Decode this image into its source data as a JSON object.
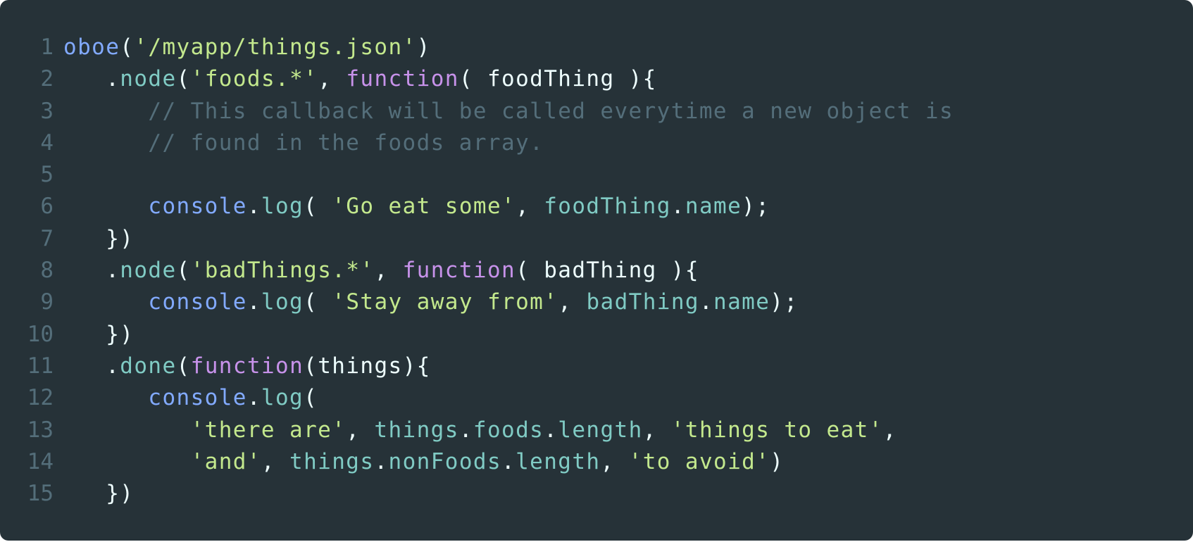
{
  "colors": {
    "background": "#263238",
    "line_number": "#546e7a",
    "function": "#82aaff",
    "string": "#c3e88d",
    "keyword": "#c792ea",
    "property": "#80cbc4",
    "comment": "#546e7a",
    "plain": "#eeffff"
  },
  "lines": [
    {
      "number": "1",
      "indent": "",
      "tokens": [
        {
          "t": "oboe",
          "c": "func"
        },
        {
          "t": "(",
          "c": "plain"
        },
        {
          "t": "'/myapp/things.json'",
          "c": "str"
        },
        {
          "t": ")",
          "c": "plain"
        }
      ]
    },
    {
      "number": "2",
      "indent": "   ",
      "tokens": [
        {
          "t": ".",
          "c": "plain"
        },
        {
          "t": "node",
          "c": "prop"
        },
        {
          "t": "(",
          "c": "plain"
        },
        {
          "t": "'foods.*'",
          "c": "str"
        },
        {
          "t": ", ",
          "c": "plain"
        },
        {
          "t": "function",
          "c": "kw"
        },
        {
          "t": "( foodThing ){",
          "c": "plain"
        }
      ]
    },
    {
      "number": "3",
      "indent": "      ",
      "tokens": [
        {
          "t": "// This callback will be called everytime a new object is",
          "c": "com"
        }
      ]
    },
    {
      "number": "4",
      "indent": "      ",
      "tokens": [
        {
          "t": "// found in the foods array.",
          "c": "com"
        }
      ]
    },
    {
      "number": "5",
      "indent": "",
      "tokens": []
    },
    {
      "number": "6",
      "indent": "      ",
      "tokens": [
        {
          "t": "console",
          "c": "func"
        },
        {
          "t": ".",
          "c": "plain"
        },
        {
          "t": "log",
          "c": "prop"
        },
        {
          "t": "( ",
          "c": "plain"
        },
        {
          "t": "'Go eat some'",
          "c": "str"
        },
        {
          "t": ", ",
          "c": "plain"
        },
        {
          "t": "foodThing",
          "c": "prop"
        },
        {
          "t": ".",
          "c": "plain"
        },
        {
          "t": "name",
          "c": "prop"
        },
        {
          "t": ");",
          "c": "plain"
        }
      ]
    },
    {
      "number": "7",
      "indent": "   ",
      "tokens": [
        {
          "t": "})",
          "c": "plain"
        }
      ]
    },
    {
      "number": "8",
      "indent": "   ",
      "tokens": [
        {
          "t": ".",
          "c": "plain"
        },
        {
          "t": "node",
          "c": "prop"
        },
        {
          "t": "(",
          "c": "plain"
        },
        {
          "t": "'badThings.*'",
          "c": "str"
        },
        {
          "t": ", ",
          "c": "plain"
        },
        {
          "t": "function",
          "c": "kw"
        },
        {
          "t": "( badThing ){",
          "c": "plain"
        }
      ]
    },
    {
      "number": "9",
      "indent": "      ",
      "tokens": [
        {
          "t": "console",
          "c": "func"
        },
        {
          "t": ".",
          "c": "plain"
        },
        {
          "t": "log",
          "c": "prop"
        },
        {
          "t": "( ",
          "c": "plain"
        },
        {
          "t": "'Stay away from'",
          "c": "str"
        },
        {
          "t": ", ",
          "c": "plain"
        },
        {
          "t": "badThing",
          "c": "prop"
        },
        {
          "t": ".",
          "c": "plain"
        },
        {
          "t": "name",
          "c": "prop"
        },
        {
          "t": ");",
          "c": "plain"
        }
      ]
    },
    {
      "number": "10",
      "indent": "   ",
      "tokens": [
        {
          "t": "})",
          "c": "plain"
        }
      ]
    },
    {
      "number": "11",
      "indent": "   ",
      "tokens": [
        {
          "t": ".",
          "c": "plain"
        },
        {
          "t": "done",
          "c": "prop"
        },
        {
          "t": "(",
          "c": "plain"
        },
        {
          "t": "function",
          "c": "kw"
        },
        {
          "t": "(things){",
          "c": "plain"
        }
      ]
    },
    {
      "number": "12",
      "indent": "      ",
      "tokens": [
        {
          "t": "console",
          "c": "func"
        },
        {
          "t": ".",
          "c": "plain"
        },
        {
          "t": "log",
          "c": "prop"
        },
        {
          "t": "(",
          "c": "plain"
        }
      ]
    },
    {
      "number": "13",
      "indent": "         ",
      "tokens": [
        {
          "t": "'there are'",
          "c": "str"
        },
        {
          "t": ", ",
          "c": "plain"
        },
        {
          "t": "things",
          "c": "prop"
        },
        {
          "t": ".",
          "c": "plain"
        },
        {
          "t": "foods",
          "c": "prop"
        },
        {
          "t": ".",
          "c": "plain"
        },
        {
          "t": "length",
          "c": "prop"
        },
        {
          "t": ", ",
          "c": "plain"
        },
        {
          "t": "'things to eat'",
          "c": "str"
        },
        {
          "t": ",",
          "c": "plain"
        }
      ]
    },
    {
      "number": "14",
      "indent": "         ",
      "tokens": [
        {
          "t": "'and'",
          "c": "str"
        },
        {
          "t": ", ",
          "c": "plain"
        },
        {
          "t": "things",
          "c": "prop"
        },
        {
          "t": ".",
          "c": "plain"
        },
        {
          "t": "nonFoods",
          "c": "prop"
        },
        {
          "t": ".",
          "c": "plain"
        },
        {
          "t": "length",
          "c": "prop"
        },
        {
          "t": ", ",
          "c": "plain"
        },
        {
          "t": "'to avoid'",
          "c": "str"
        },
        {
          "t": ")",
          "c": "plain"
        }
      ]
    },
    {
      "number": "15",
      "indent": "   ",
      "tokens": [
        {
          "t": "})",
          "c": "plain"
        }
      ]
    }
  ]
}
